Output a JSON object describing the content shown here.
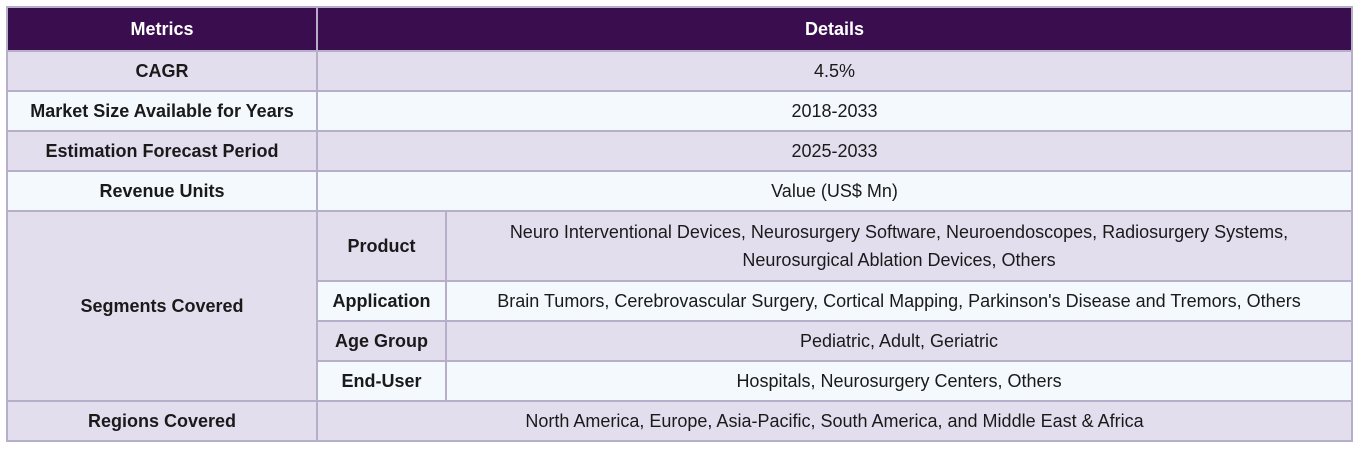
{
  "header": {
    "metrics": "Metrics",
    "details": "Details"
  },
  "rows": {
    "cagr": {
      "label": "CAGR",
      "value": "4.5%"
    },
    "market_size": {
      "label": "Market Size Available for Years",
      "value": "2018-2033"
    },
    "forecast": {
      "label": "Estimation Forecast Period",
      "value": "2025-2033"
    },
    "revenue": {
      "label": "Revenue Units",
      "value": "Value (US$ Mn)"
    },
    "segments": {
      "label": "Segments Covered",
      "items": [
        {
          "label": "Product",
          "value": "Neuro Interventional Devices, Neurosurgery Software, Neuroendoscopes, Radiosurgery Systems, Neurosurgical Ablation Devices, Others"
        },
        {
          "label": "Application",
          "value": "Brain Tumors, Cerebrovascular Surgery, Cortical Mapping, Parkinson's Disease and Tremors, Others"
        },
        {
          "label": "Age Group",
          "value": "Pediatric, Adult, Geriatric"
        },
        {
          "label": "End-User",
          "value": "Hospitals, Neurosurgery Centers, Others"
        }
      ]
    },
    "regions": {
      "label": "Regions Covered",
      "value": "North America, Europe, Asia-Pacific, South America, and Middle East & Africa"
    }
  }
}
